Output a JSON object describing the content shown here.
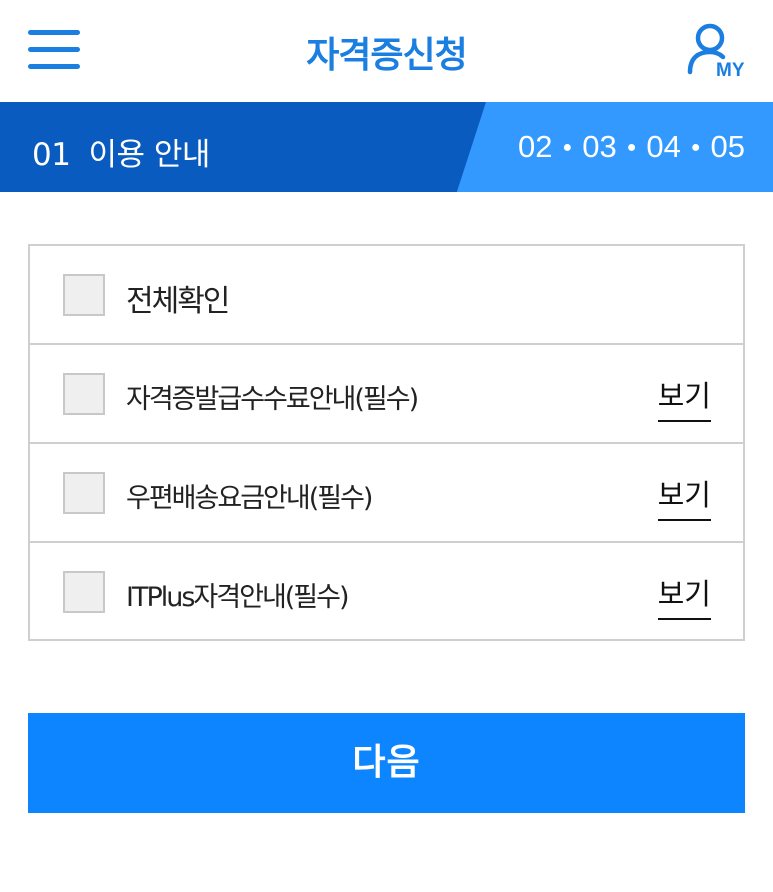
{
  "header": {
    "title": "자격증신청",
    "menu_icon": "hamburger-menu-icon",
    "my_icon": "user-icon",
    "my_label": "MY",
    "accent_color": "#1a7fe0"
  },
  "steps": {
    "current_number": "01",
    "current_label": "이용 안내",
    "others": [
      "02",
      "03",
      "04",
      "05"
    ],
    "current_bg_color": "#0a5bc0",
    "other_bg_color": "#3399ff"
  },
  "agreements": {
    "all_label": "전체확인",
    "items": [
      {
        "label": "자격증발급수수료안내(필수)",
        "view_label": "보기",
        "checked": false
      },
      {
        "label": "우편배송요금안내(필수)",
        "view_label": "보기",
        "checked": false
      },
      {
        "label": "ITPlus자격안내(필수)",
        "view_label": "보기",
        "checked": false
      }
    ]
  },
  "next_button": {
    "label": "다음",
    "color": "#0d85ff"
  }
}
